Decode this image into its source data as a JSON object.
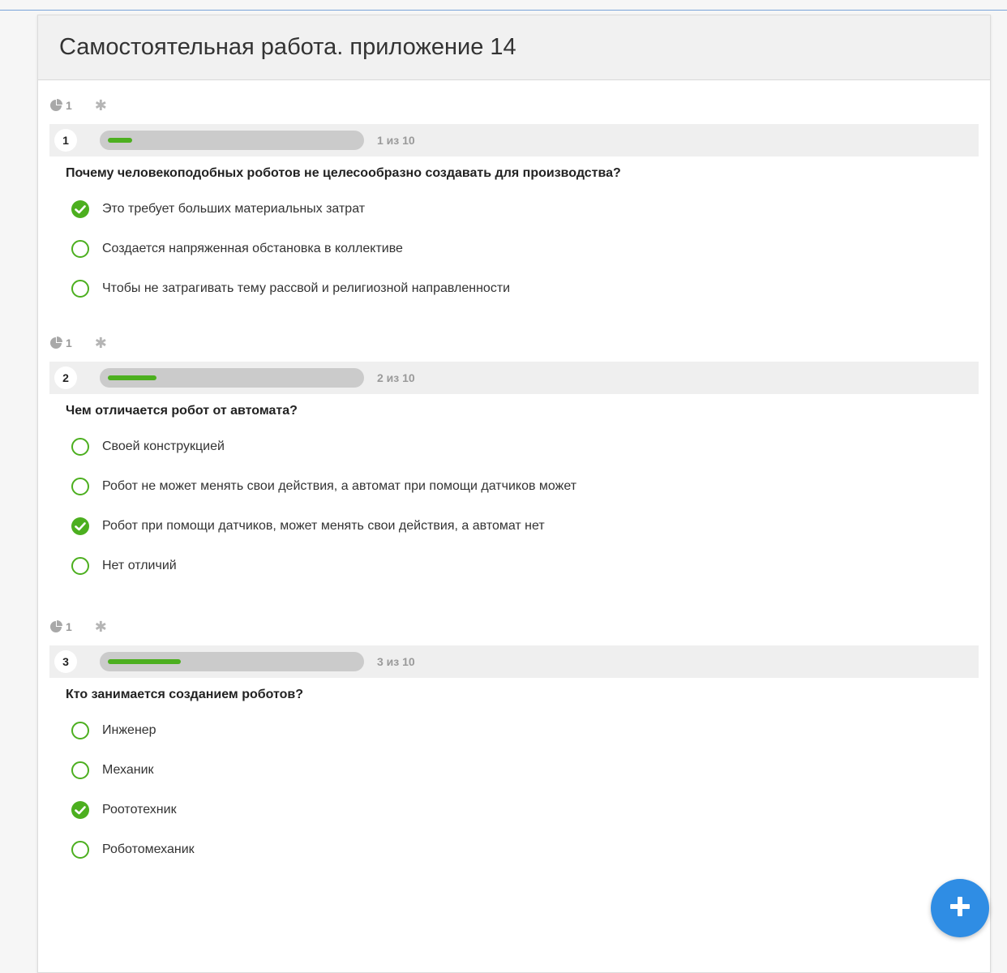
{
  "title": "Самостоятельная работа. приложение 14",
  "questions": [
    {
      "points": "1",
      "number": "1",
      "progress_text": "1 из 10",
      "progress": 0.1,
      "text": "Почему человекоподобных роботов не целесообразно создавать для производства?",
      "answers": [
        {
          "label": "Это требует больших материальных затрат",
          "checked": true
        },
        {
          "label": "Создается напряженная обстановка в коллективе",
          "checked": false
        },
        {
          "label": "Чтобы не затрагивать тему рассвой и религиозной направленности",
          "checked": false
        }
      ]
    },
    {
      "points": "1",
      "number": "2",
      "progress_text": "2 из 10",
      "progress": 0.2,
      "text": "Чем отличается робот от автомата?",
      "answers": [
        {
          "label": "Своей конструкцией",
          "checked": false
        },
        {
          "label": "Робот не может менять свои действия, а автомат при помощи датчиков может",
          "checked": false
        },
        {
          "label": "Робот при помощи датчиков, может менять свои действия, а автомат нет",
          "checked": true
        },
        {
          "label": "Нет отличий",
          "checked": false
        }
      ]
    },
    {
      "points": "1",
      "number": "3",
      "progress_text": "3 из 10",
      "progress": 0.3,
      "text": "Кто занимается созданием роботов?",
      "answers": [
        {
          "label": "Инженер",
          "checked": false
        },
        {
          "label": "Механик",
          "checked": false
        },
        {
          "label": "Роототехник",
          "checked": true
        },
        {
          "label": "Роботомеханик",
          "checked": false
        }
      ]
    }
  ],
  "colors": {
    "accent_green": "#4caf1f",
    "fab_blue": "#2f8de4"
  },
  "icons": {
    "points": "pie-chart-icon",
    "required": "asterisk-icon",
    "add": "plus-icon"
  }
}
